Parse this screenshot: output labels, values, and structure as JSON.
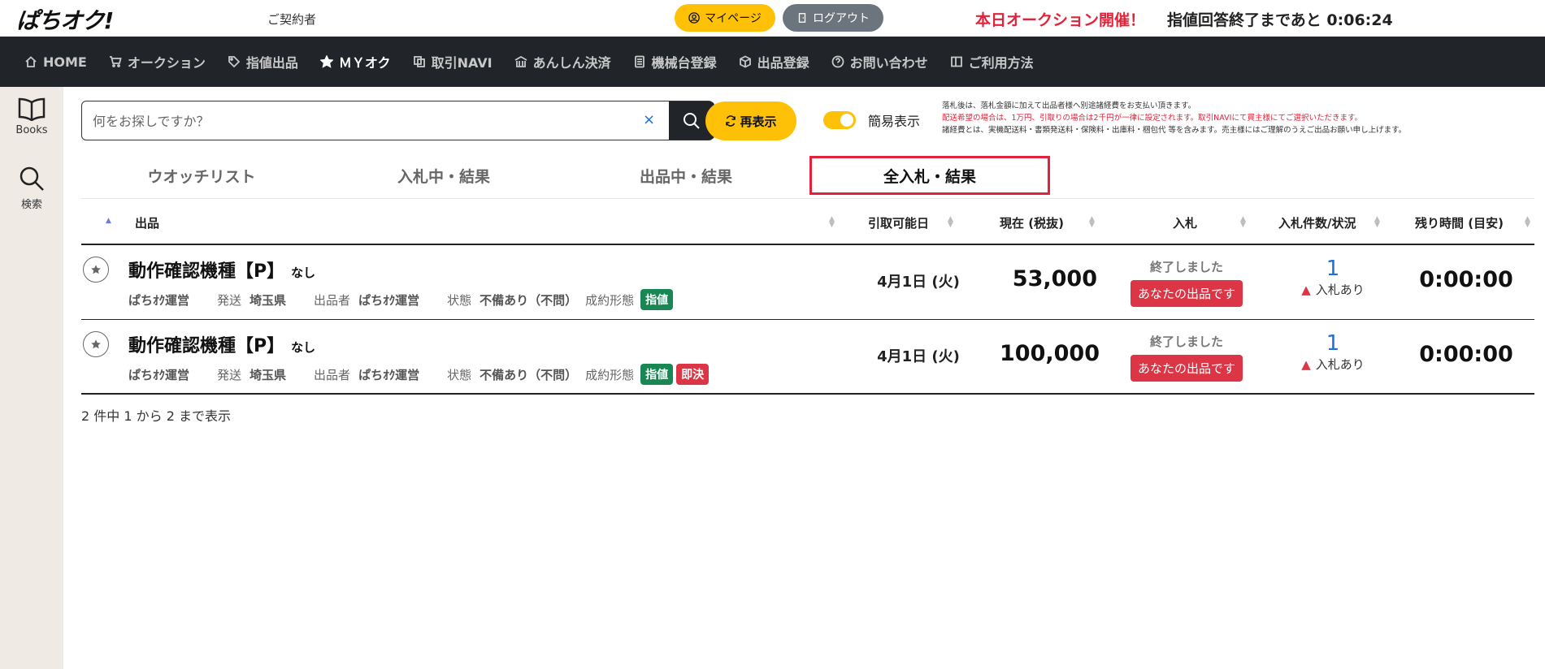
{
  "header": {
    "logo_text": "ぱちオク!",
    "contractor": "ご契約者",
    "mypage_label": "マイページ",
    "logout_label": "ログアウト",
    "auction_open": "本日オークション開催！",
    "countdown": "指値回答終了まであと 0:06:24"
  },
  "nav": {
    "items": [
      {
        "label": "HOME",
        "icon": "home-icon"
      },
      {
        "label": "オークション",
        "icon": "cart-icon"
      },
      {
        "label": "指値出品",
        "icon": "tag-icon"
      },
      {
        "label": "ＭＹオク",
        "icon": "star-icon"
      },
      {
        "label": "取引NAVI",
        "icon": "copy-icon"
      },
      {
        "label": "あんしん決済",
        "icon": "bank-icon"
      },
      {
        "label": "機械台登録",
        "icon": "machine-icon"
      },
      {
        "label": "出品登録",
        "icon": "box-icon"
      },
      {
        "label": "お問い合わせ",
        "icon": "question-icon"
      },
      {
        "label": "ご利用方法",
        "icon": "book-icon"
      }
    ],
    "active_index": 3
  },
  "sidebar": {
    "items": [
      {
        "label": "Books",
        "icon": "book-open-icon"
      },
      {
        "label": "検索",
        "icon": "search-icon"
      }
    ]
  },
  "search": {
    "placeholder": "何をお探しですか？",
    "clear_label": "×"
  },
  "controls": {
    "refresh_label": "再表示",
    "toggle_label": "簡易表示",
    "toggle_on": true
  },
  "notes": {
    "line1": "落札後は、落札金額に加えて出品者様へ別途諸経費をお支払い頂きます。",
    "line2": "配送希望の場合は、1万円、引取りの場合は2千円が一律に設定されます。取引NAVIにて買主様にてご選択いただきます。",
    "line3": "諸経費とは、実機配送料・書類発送料・保険料・出庫料・梱包代 等を含みます。売主様にはご理解のうえご出品お願い申し上げます。"
  },
  "tabs": [
    {
      "label": "ウオッチリスト",
      "active": false
    },
    {
      "label": "入札中・結果",
      "active": false
    },
    {
      "label": "出品中・結果",
      "active": false
    },
    {
      "label": "全入札・結果",
      "active": true
    }
  ],
  "table": {
    "columns": [
      "出品",
      "引取可能日",
      "現在 (税抜)",
      "入札",
      "入札件数/状況",
      "残り時間 (目安)"
    ],
    "rows": [
      {
        "title": "動作確認機種【P】",
        "sub": "なし",
        "seller_label": "ぱちｵｸ運営",
        "ship_key": "発送",
        "ship_val": "埼玉県",
        "exhibitor_key": "出品者",
        "exhibitor_val": "ぱちｵｸ運営",
        "condition_key": "状態",
        "condition_val": "不備あり（不問）",
        "contract_key": "成約形態",
        "badges": [
          {
            "label": "指値",
            "color": "green"
          }
        ],
        "date": "4月1日 (火)",
        "price": "53,000",
        "status_ended": "終了しました",
        "status_yours": "あなたの出品です",
        "bid_count": "1",
        "bid_alert": "入札あり",
        "remaining": "0:00:00"
      },
      {
        "title": "動作確認機種【P】",
        "sub": "なし",
        "seller_label": "ぱちｵｸ運営",
        "ship_key": "発送",
        "ship_val": "埼玉県",
        "exhibitor_key": "出品者",
        "exhibitor_val": "ぱちｵｸ運営",
        "condition_key": "状態",
        "condition_val": "不備あり（不問）",
        "contract_key": "成約形態",
        "badges": [
          {
            "label": "指値",
            "color": "green"
          },
          {
            "label": "即決",
            "color": "red"
          }
        ],
        "date": "4月1日 (火)",
        "price": "100,000",
        "status_ended": "終了しました",
        "status_yours": "あなたの出品です",
        "bid_count": "1",
        "bid_alert": "入札あり",
        "remaining": "0:00:00"
      }
    ],
    "footer": "2 件中 1 から 2 まで表示"
  },
  "colors": {
    "accent_yellow": "#ffc107",
    "nav_bg": "#212529",
    "red": "#e0233a",
    "green": "#198754",
    "sidebar_bg": "#efebe4"
  }
}
